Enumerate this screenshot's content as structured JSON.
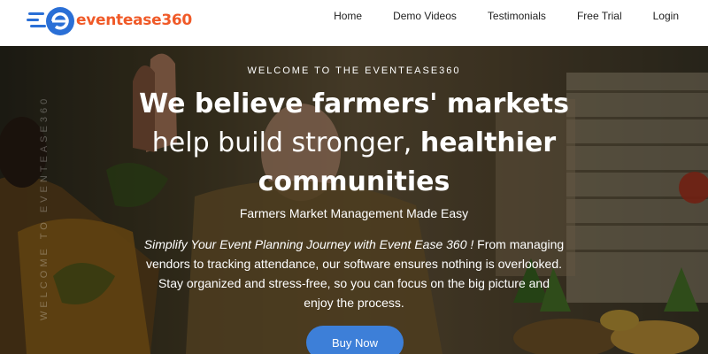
{
  "brand": {
    "logo_text": "eventease360"
  },
  "nav": [
    {
      "label": "Home"
    },
    {
      "label": "Demo Videos"
    },
    {
      "label": "Testimonials"
    },
    {
      "label": "Free Trial"
    },
    {
      "label": "Login"
    }
  ],
  "hero": {
    "side_text": "WELCOME TO EVENTEASE360",
    "eyebrow": "WELCOME TO THE EVENTEASE360",
    "headline": {
      "bold1": "We believe farmers' markets",
      "normal1": " help build stronger, ",
      "bold2": "healthier communities"
    },
    "subhead": "Farmers Market Management Made Easy",
    "description": {
      "italic": "Simplify Your Event Planning Journey with Event Ease 360 !",
      "rest": " From managing vendors to tracking attendance, our software ensures nothing is overlooked. Stay organized and stress-free, so you can focus on the big picture and enjoy the process."
    },
    "cta_label": "Buy Now"
  },
  "colors": {
    "brand_orange": "#f05a28",
    "brand_blue": "#2a6fd6",
    "cta_blue": "#3d7fd8"
  }
}
